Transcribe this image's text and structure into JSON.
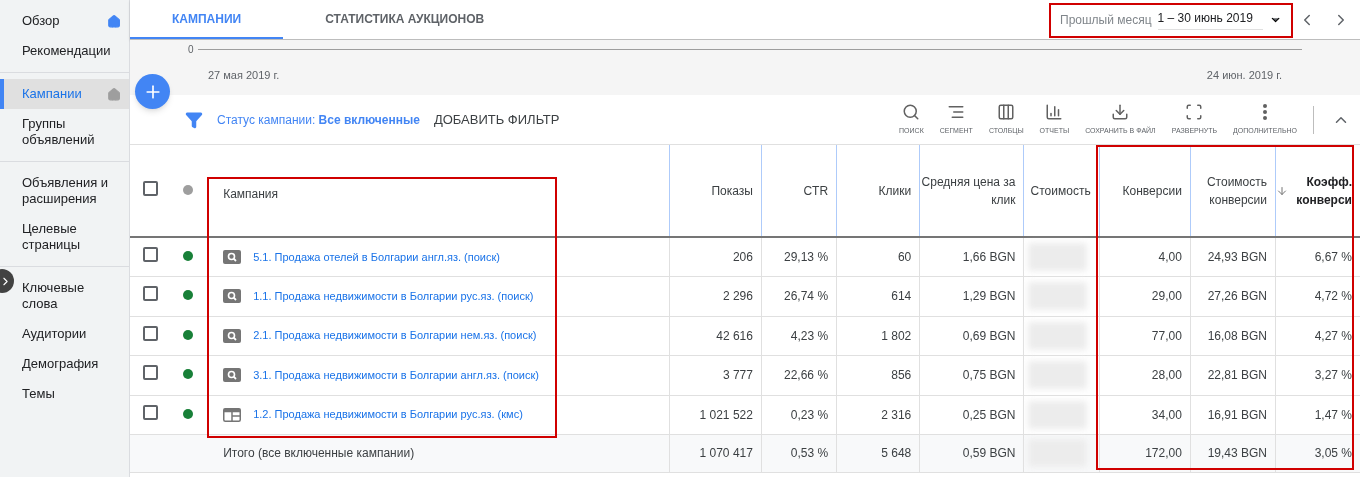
{
  "sidebar": {
    "groups": [
      [
        {
          "label": "Обзор",
          "selected": false,
          "home_icon": true
        },
        {
          "label": "Рекомендации",
          "selected": false,
          "home_icon": false
        }
      ],
      [
        {
          "label": "Кампании",
          "selected": true,
          "home_icon": true
        },
        {
          "label": "Группы объявлений",
          "selected": false,
          "home_icon": false
        }
      ],
      [
        {
          "label": "Объявления и расширения",
          "selected": false,
          "home_icon": false
        },
        {
          "label": "Целевые страницы",
          "selected": false,
          "home_icon": false
        }
      ],
      [
        {
          "label": "Ключевые слова",
          "selected": false,
          "home_icon": false
        },
        {
          "label": "Аудитории",
          "selected": false,
          "home_icon": false
        },
        {
          "label": "Демография",
          "selected": false,
          "home_icon": false
        },
        {
          "label": "Темы",
          "selected": false,
          "home_icon": false
        }
      ]
    ]
  },
  "tabs": [
    {
      "label": "КАМПАНИИ",
      "selected": true
    },
    {
      "label": "СТАТИСТИКА АУКЦИОНОВ",
      "selected": false
    }
  ],
  "date_range": {
    "preset": "Прошлый месяц",
    "value": "1 – 30 июнь 2019"
  },
  "chart": {
    "y_tick": "0",
    "x_labels": [
      "27 мая 2019 г.",
      "24 июн. 2019 г."
    ]
  },
  "filter": {
    "label": "Статус кампании: **Все включенные**",
    "add": "ДОБАВИТЬ ФИЛЬТР"
  },
  "toolbar": [
    {
      "label": "ПОИСК"
    },
    {
      "label": "СЕГМЕНТ"
    },
    {
      "label": "СТОЛБЦЫ"
    },
    {
      "label": "ОТЧЕТЫ"
    },
    {
      "label": "СОХРАНИТЬ В ФАЙЛ"
    },
    {
      "label": "РАЗВЕРНУТЬ"
    },
    {
      "label": "ДОПОЛНИТЕЛЬНО"
    }
  ],
  "table": {
    "select_all_checked": false,
    "columns": [
      {
        "label": "Кампания",
        "sorted": false
      },
      {
        "label": "Показы",
        "sorted": false
      },
      {
        "label": "CTR",
        "sorted": false
      },
      {
        "label": "Клики",
        "sorted": false
      },
      {
        "label": "Средняя цена за клик",
        "sorted": false
      },
      {
        "label": "Стоимость",
        "sorted": false
      },
      {
        "label": "Конверсии",
        "sorted": false
      },
      {
        "label": "Стоимость конверсии",
        "sorted": false
      },
      {
        "label": "Коэфф. конверси",
        "sorted": true
      }
    ],
    "rows": [
      {
        "checked": false,
        "color": "#188038",
        "kind": "search",
        "cells": [
          "5.1. Продажа отелей в Болгарии англ.яз. (поиск)",
          "206",
          "29,13 %",
          "60",
          "1,66 BGN",
          "",
          "4,00",
          "24,93 BGN",
          "6,67 %"
        ],
        "cost_blurred": true
      },
      {
        "checked": false,
        "color": "#188038",
        "kind": "search",
        "cells": [
          "1.1. Продажа недвижимости в Болгарии рус.яз. (поиск)",
          "2 296",
          "26,74 %",
          "614",
          "1,29 BGN",
          "",
          "29,00",
          "27,26 BGN",
          "4,72 %"
        ],
        "cost_blurred": true
      },
      {
        "checked": false,
        "color": "#188038",
        "kind": "search",
        "cells": [
          "2.1. Продажа недвижимости в Болгарии нем.яз. (поиск)",
          "42 616",
          "4,23 %",
          "1 802",
          "0,69 BGN",
          "",
          "77,00",
          "16,08 BGN",
          "4,27 %"
        ],
        "cost_blurred": true
      },
      {
        "checked": false,
        "color": "#188038",
        "kind": "search",
        "cells": [
          "3.1. Продажа недвижимости в Болгарии англ.яз. (поиск)",
          "3 777",
          "22,66 %",
          "856",
          "0,75 BGN",
          "",
          "28,00",
          "22,81 BGN",
          "3,27 %"
        ],
        "cost_blurred": true
      },
      {
        "checked": false,
        "color": "#188038",
        "kind": "display",
        "cells": [
          "1.2. Продажа недвижимости в Болгарии рус.яз. (кмс)",
          "1 021 522",
          "0,23 %",
          "2 316",
          "0,25 BGN",
          "",
          "34,00",
          "16,91 BGN",
          "1,47 %"
        ],
        "cost_blurred": true
      }
    ],
    "total": {
      "cells": [
        "Итого (все включенные кампании)",
        "1 070 417",
        "0,53 %",
        "5 648",
        "0,59 BGN",
        "",
        "172,00",
        "19,43 BGN",
        "3,05 %"
      ],
      "cost_blurred": true
    }
  }
}
